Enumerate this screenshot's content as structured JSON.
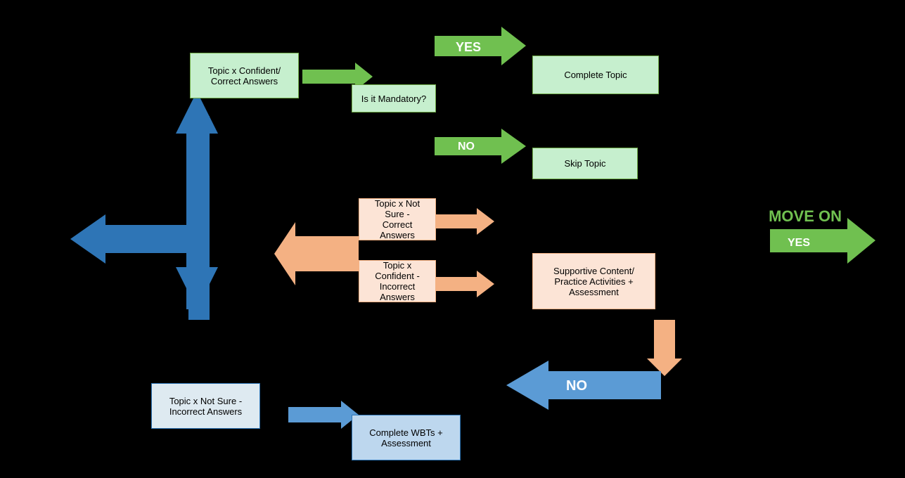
{
  "boxes": {
    "topic_confident_correct": {
      "label": "Topic x Confident/\nCorrect Answers"
    },
    "complete_topic": {
      "label": "Complete Topic"
    },
    "is_mandatory": {
      "label": "Is it Mandatory?"
    },
    "skip_topic": {
      "label": "Skip Topic"
    },
    "topic_not_sure_correct": {
      "label": "Topic x Not Sure -\nCorrect Answers"
    },
    "topic_confident_incorrect": {
      "label": "Topic x Confident -\nIncorrect Answers"
    },
    "supportive_content": {
      "label": "Supportive Content/\nPractice Activities +\nAssessment"
    },
    "topic_not_sure_incorrect": {
      "label": "Topic x Not Sure -\nIncorrect Answers"
    },
    "complete_wbts": {
      "label": "Complete WBTs +\nAssessment"
    }
  },
  "arrows": {
    "yes_top": {
      "label": "YES"
    },
    "no_label": {
      "label": "NO"
    },
    "yes_right": {
      "label": "YES"
    },
    "no_bottom": {
      "label": "NO"
    },
    "move_on": {
      "label": "MOVE ON"
    }
  }
}
